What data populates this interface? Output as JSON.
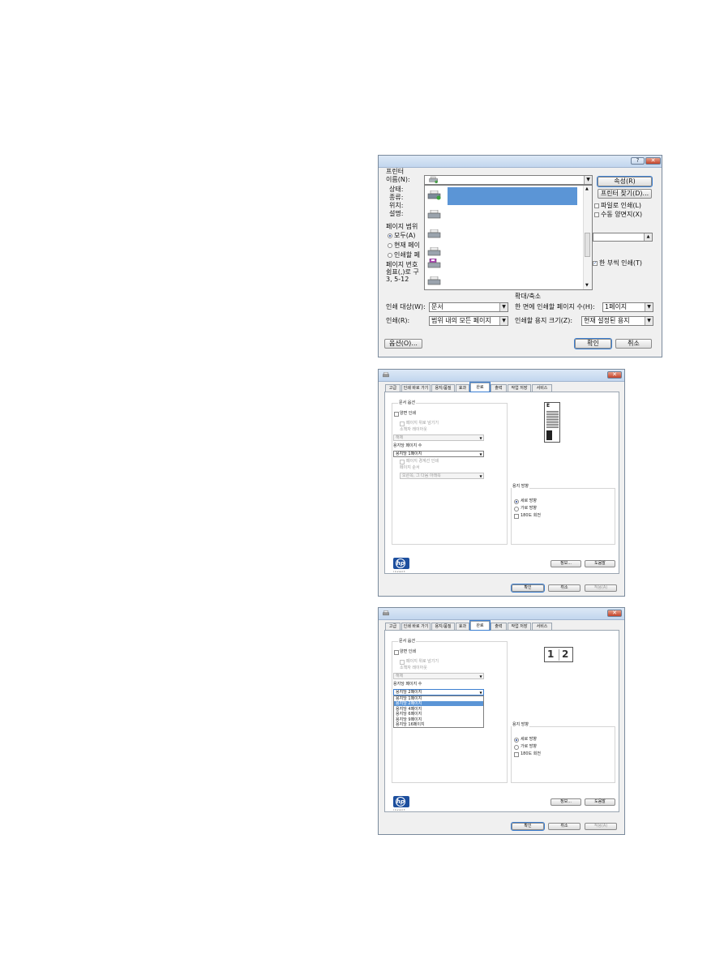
{
  "print_dialog": {
    "printer_section": "프린터",
    "name_label": "이름(N):",
    "status_label": "상태:",
    "type_label": "종류:",
    "where_label": "위치:",
    "comment_label": "설명:",
    "properties_button": "속성(R)",
    "find_printer_button": "프린터 찾기(D)...",
    "print_to_file_label": "파일로 인쇄(L)",
    "manual_duplex_label": "수동 양면지(X)",
    "page_range_section": "페이지 범위",
    "all_label": "모두(A)",
    "current_page_label": "현재 페이",
    "selection_label": "인쇄할 페",
    "page_number_label": "페이지 번호",
    "page_number_hint_1": "쉼표(,)로 구",
    "page_number_hint_2": "3, 5-12",
    "collate_label": "한 부씩 인쇄(T)",
    "zoom_section": "확대/축소",
    "print_what_label": "인쇄 대상(W):",
    "print_what_value": "문서",
    "pages_per_sheet_label": "한 면에 인쇄할 페이지 수(H):",
    "pages_per_sheet_value": "1페이지",
    "print_label": "인쇄(R):",
    "print_value": "범위 내의 모든 페이지",
    "scale_label": "인쇄할 용지 크기(Z):",
    "scale_value": "현재 설정된 용지",
    "options_button": "옵션(O)...",
    "ok_button": "확인",
    "cancel_button": "취소"
  },
  "properties_dialog_1": {
    "tabs": [
      "고급",
      "인쇄 바로 가기",
      "용지/품질",
      "효과",
      "완료",
      "출력",
      "작업 저장",
      "서비스"
    ],
    "active_tab": "완료",
    "document_options": "문서 옵션",
    "duplex_label": "양면 인쇄",
    "flip_pages_up_label": "페이지 위로 넘기기",
    "booklet_layout_label": "소책자 레이아웃",
    "booklet_value": "해제",
    "pages_per_sheet_label": "용지당 페이지 수",
    "pages_per_sheet_value": "용지당 1페이지",
    "print_page_borders_label": "페이지 경계선 인쇄",
    "page_order_label": "페이지 순서",
    "page_order_value": "오른쪽, 그 다음 아래쪽",
    "orientation_section": "용지 방향",
    "portrait_label": "세로 방향",
    "landscape_label": "가로 방향",
    "rotate_label": "180도 회전",
    "about_button": "정보...",
    "help_button": "도움말",
    "ok_button": "확인",
    "cancel_button": "취소",
    "apply_button": "적용(A)",
    "preview_letter": "E",
    "hp_tagline": "invent"
  },
  "properties_dialog_2": {
    "tabs": [
      "고급",
      "인쇄 바로 가기",
      "용지/품질",
      "효과",
      "완료",
      "출력",
      "작업 저장",
      "서비스"
    ],
    "active_tab": "완료",
    "document_options": "문서 옵션",
    "duplex_label": "양면 인쇄",
    "flip_pages_up_label": "페이지 위로 넘기기",
    "booklet_layout_label": "소책자 레이아웃",
    "booklet_value": "해제",
    "pages_per_sheet_label": "용지당 페이지 수",
    "pages_per_sheet_value": "용지당 2페이지",
    "pages_per_sheet_options": [
      "용지당 1페이지",
      "용지당 2페이지",
      "용지당 4페이지",
      "용지당 6페이지",
      "용지당 9페이지",
      "용지당 16페이지"
    ],
    "selected_option_index": 1,
    "orientation_section": "용지 방향",
    "portrait_label": "세로 방향",
    "landscape_label": "가로 방향",
    "rotate_label": "180도 회전",
    "about_button": "정보...",
    "help_button": "도움말",
    "ok_button": "확인",
    "cancel_button": "취소",
    "apply_button": "적용(A)",
    "preview_page_1": "1",
    "preview_page_2": "2",
    "hp_tagline": "invent"
  },
  "colors": {
    "highlight": "#5b95d6",
    "focus": "#3c7fd1",
    "hp_blue": "#1d4f9e"
  }
}
